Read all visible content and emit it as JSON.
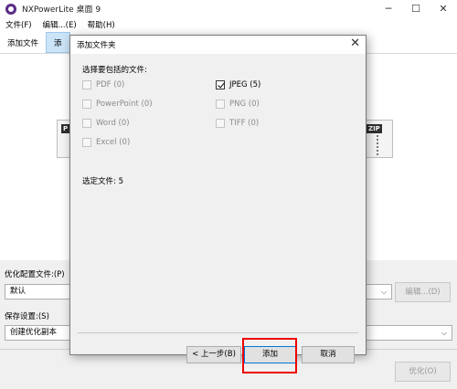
{
  "window": {
    "title": "NXPowerLite 桌面 9",
    "minimize": "─",
    "maximize": "☐",
    "close": "✕"
  },
  "menu": [
    "文件(F)",
    "编辑...(E)",
    "帮助(H)"
  ],
  "toolbar": {
    "add_file": "添加文件",
    "add_folder_partial": "添"
  },
  "file_tags": {
    "left": "P",
    "right": "ZIP"
  },
  "settings": {
    "profile_label": "优化配置文件:(P)",
    "profile_value": "默认",
    "edit_button": "编辑...(D)",
    "save_label": "保存设置:(S)",
    "save_value": "创建优化副本",
    "optimize_button": "优化(O)"
  },
  "dialog": {
    "title": "添加文件夹",
    "close": "✕",
    "heading": "选择要包括的文件:",
    "file_types": [
      {
        "label": "PDF (0)",
        "checked": false,
        "enabled": false
      },
      {
        "label": "PowerPoint (0)",
        "checked": false,
        "enabled": false
      },
      {
        "label": "Word (0)",
        "checked": false,
        "enabled": false
      },
      {
        "label": "Excel (0)",
        "checked": false,
        "enabled": false
      },
      {
        "label": "JPEG (5)",
        "checked": true,
        "enabled": true
      },
      {
        "label": "PNG (0)",
        "checked": false,
        "enabled": false
      },
      {
        "label": "TIFF (0)",
        "checked": false,
        "enabled": false
      }
    ],
    "selected_files": "选定文件: 5",
    "back_button": "< 上一步(B)",
    "add_button": "添加",
    "cancel_button": "取消"
  },
  "colors": {
    "highlight": "#e00000",
    "accent": "#0078d7",
    "toolbar_active": "#cce4f7"
  }
}
